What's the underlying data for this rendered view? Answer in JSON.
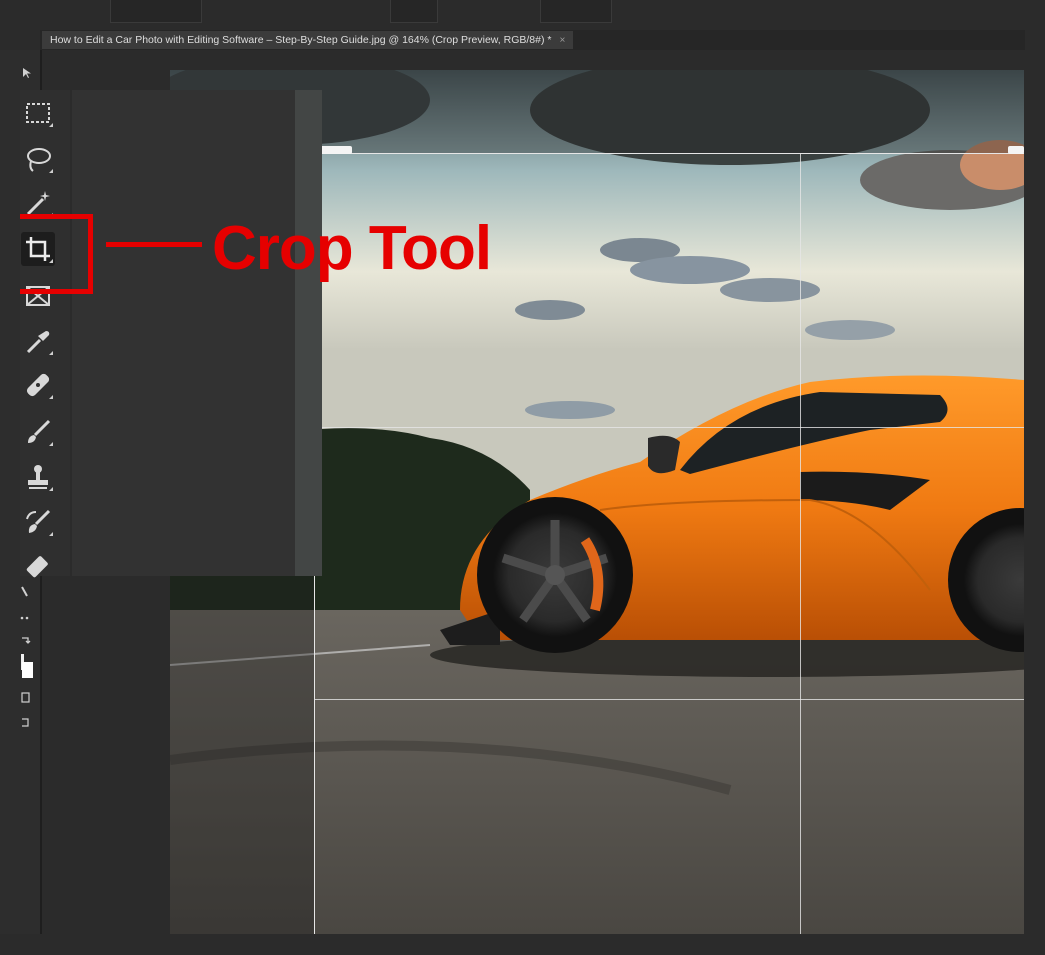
{
  "document": {
    "tab_title": "How to Edit a Car Photo with Editing Software – Step-By-Step Guide.jpg @ 164% (Crop Preview, RGB/8#) *",
    "close_glyph": "×"
  },
  "toolbar": {
    "tools": [
      {
        "name": "rectangular-marquee-icon",
        "active": false
      },
      {
        "name": "lasso-icon",
        "active": false
      },
      {
        "name": "magic-wand-icon",
        "active": false
      },
      {
        "name": "crop-icon",
        "active": true
      },
      {
        "name": "frame-icon",
        "active": false
      },
      {
        "name": "eyedropper-icon",
        "active": false
      },
      {
        "name": "healing-brush-icon",
        "active": false
      },
      {
        "name": "brush-icon",
        "active": false
      },
      {
        "name": "clone-stamp-icon",
        "active": false
      },
      {
        "name": "history-brush-icon",
        "active": false
      },
      {
        "name": "eraser-icon",
        "active": false
      }
    ]
  },
  "annotation": {
    "label": "Crop Tool",
    "color": "#e60000"
  },
  "colors": {
    "car_orange": "#f07a12",
    "ui_dark": "#2b2b2b",
    "guide": "#e6e6e6"
  }
}
